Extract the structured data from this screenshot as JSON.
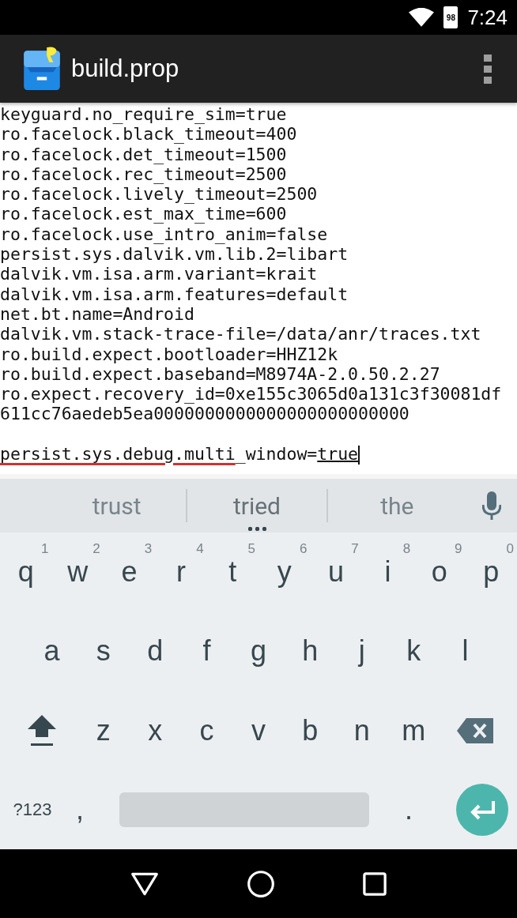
{
  "status_bar": {
    "battery": "98",
    "time": "7:24"
  },
  "toolbar": {
    "title": "build.prop"
  },
  "editor": {
    "lines": [
      {
        "kind": "text",
        "text": "keyguard.no_require_sim=true"
      },
      {
        "kind": "text",
        "text": "ro.facelock.black_timeout=400"
      },
      {
        "kind": "text",
        "text": "ro.facelock.det_timeout=1500"
      },
      {
        "kind": "text",
        "text": "ro.facelock.rec_timeout=2500"
      },
      {
        "kind": "text",
        "text": "ro.facelock.lively_timeout=2500"
      },
      {
        "kind": "text",
        "text": "ro.facelock.est_max_time=600"
      },
      {
        "kind": "text",
        "text": "ro.facelock.use_intro_anim=false"
      },
      {
        "kind": "text",
        "text": "persist.sys.dalvik.vm.lib.2=libart"
      },
      {
        "kind": "text",
        "text": "dalvik.vm.isa.arm.variant=krait"
      },
      {
        "kind": "text",
        "text": "dalvik.vm.isa.arm.features=default"
      },
      {
        "kind": "text",
        "text": "net.bt.name=Android"
      },
      {
        "kind": "text",
        "text": "dalvik.vm.stack-trace-file=/data/anr/traces.txt"
      },
      {
        "kind": "text",
        "text": "ro.build.expect.bootloader=HHZ12k"
      },
      {
        "kind": "text",
        "text": "ro.build.expect.baseband=M8974A-2.0.50.2.27"
      },
      {
        "kind": "text",
        "text": "ro.expect.recovery_id=0xe155c3065d0a131c3f30081df"
      },
      {
        "kind": "text",
        "text": "611cc76aedeb5ea0000000000000000000000000"
      },
      {
        "kind": "blank"
      },
      {
        "kind": "editing",
        "segments": [
          {
            "kind": "misspelled",
            "text": "persist.sys.debug.multi"
          },
          {
            "kind": "plain",
            "text": "_window="
          },
          {
            "kind": "composing",
            "text": "true"
          }
        ]
      }
    ]
  },
  "keyboard": {
    "suggestions": [
      {
        "text": "trust",
        "selected": false
      },
      {
        "text": "tried",
        "selected": true
      },
      {
        "text": "the",
        "selected": false
      }
    ],
    "rows": [
      {
        "keys": [
          {
            "kind": "letter",
            "label": "q",
            "hint": "1"
          },
          {
            "kind": "letter",
            "label": "w",
            "hint": "2"
          },
          {
            "kind": "letter",
            "label": "e",
            "hint": "3"
          },
          {
            "kind": "letter",
            "label": "r",
            "hint": "4"
          },
          {
            "kind": "letter",
            "label": "t",
            "hint": "5"
          },
          {
            "kind": "letter",
            "label": "y",
            "hint": "6"
          },
          {
            "kind": "letter",
            "label": "u",
            "hint": "7"
          },
          {
            "kind": "letter",
            "label": "i",
            "hint": "8"
          },
          {
            "kind": "letter",
            "label": "o",
            "hint": "9"
          },
          {
            "kind": "letter",
            "label": "p",
            "hint": "0"
          }
        ]
      },
      {
        "keys": [
          {
            "kind": "letter",
            "label": "a"
          },
          {
            "kind": "letter",
            "label": "s"
          },
          {
            "kind": "letter",
            "label": "d"
          },
          {
            "kind": "letter",
            "label": "f"
          },
          {
            "kind": "letter",
            "label": "g"
          },
          {
            "kind": "letter",
            "label": "h"
          },
          {
            "kind": "letter",
            "label": "j"
          },
          {
            "kind": "letter",
            "label": "k"
          },
          {
            "kind": "letter",
            "label": "l"
          }
        ]
      },
      {
        "keys": [
          {
            "kind": "shift"
          },
          {
            "kind": "letter",
            "label": "z"
          },
          {
            "kind": "letter",
            "label": "x"
          },
          {
            "kind": "letter",
            "label": "c"
          },
          {
            "kind": "letter",
            "label": "v"
          },
          {
            "kind": "letter",
            "label": "b"
          },
          {
            "kind": "letter",
            "label": "n"
          },
          {
            "kind": "letter",
            "label": "m"
          },
          {
            "kind": "backspace"
          }
        ]
      },
      {
        "keys": [
          {
            "kind": "symbols",
            "label": "?123"
          },
          {
            "kind": "letter",
            "label": ","
          },
          {
            "kind": "space"
          },
          {
            "kind": "letter",
            "label": "."
          },
          {
            "kind": "enter"
          }
        ]
      }
    ]
  }
}
